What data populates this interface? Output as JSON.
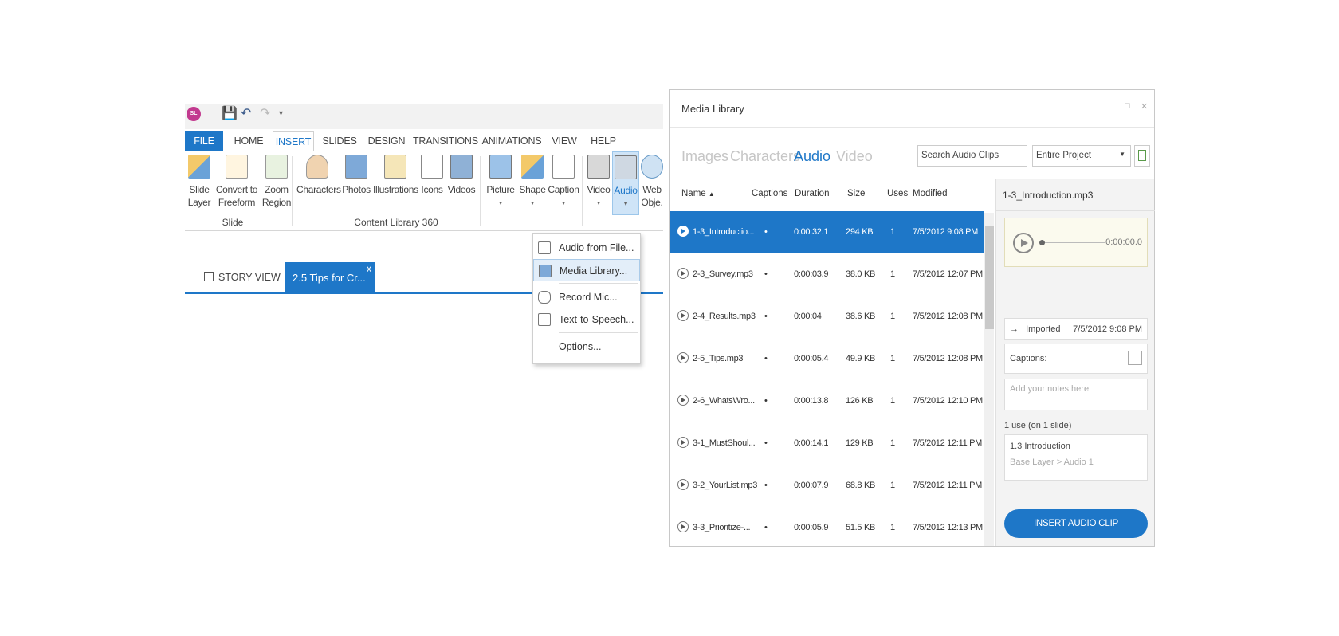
{
  "qat": {
    "logo": "SL"
  },
  "ribbon_tabs": [
    "FILE",
    "HOME",
    "INSERT",
    "SLIDES",
    "DESIGN",
    "TRANSITIONS",
    "ANIMATIONS",
    "VIEW",
    "HELP"
  ],
  "ribbon": {
    "slide_layer": "Slide\nLayer",
    "convert": "Convert to\nFreeform",
    "zoom": "Zoom\nRegion",
    "slide_group": "Slide",
    "characters": "Characters",
    "photos": "Photos",
    "illustrations": "Illustrations",
    "icons": "Icons",
    "videos": "Videos",
    "content_group": "Content Library 360",
    "picture": "Picture",
    "shape": "Shape",
    "caption": "Caption",
    "video": "Video",
    "audio": "Audio",
    "web": "Web\nObje."
  },
  "story": {
    "view_label": "STORY VIEW",
    "slide_tab": "2.5 Tips for Cr...",
    "close": "x"
  },
  "audio_menu": [
    "Audio from File...",
    "Media Library...",
    "Record Mic...",
    "Text-to-Speech...",
    "Options..."
  ],
  "media_library": {
    "title": "Media Library",
    "tabs": [
      "Images",
      "Characters",
      "Audio",
      "Video"
    ],
    "search_placeholder": "Search Audio Clips",
    "scope": "Entire Project",
    "columns": [
      "Name",
      "Captions",
      "Duration",
      "Size",
      "Uses",
      "Modified"
    ],
    "rows": [
      {
        "name": "1-3_Introductio...",
        "captions": "•",
        "duration": "0:00:32.1",
        "size": "294 KB",
        "uses": "1",
        "modified": "7/5/2012 9:08 PM"
      },
      {
        "name": "2-3_Survey.mp3",
        "captions": "•",
        "duration": "0:00:03.9",
        "size": "38.0 KB",
        "uses": "1",
        "modified": "7/5/2012 12:07 PM"
      },
      {
        "name": "2-4_Results.mp3",
        "captions": "•",
        "duration": "0:00:04",
        "size": "38.6 KB",
        "uses": "1",
        "modified": "7/5/2012 12:08 PM"
      },
      {
        "name": "2-5_Tips.mp3",
        "captions": "•",
        "duration": "0:00:05.4",
        "size": "49.9 KB",
        "uses": "1",
        "modified": "7/5/2012 12:08 PM"
      },
      {
        "name": "2-6_WhatsWro...",
        "captions": "•",
        "duration": "0:00:13.8",
        "size": "126 KB",
        "uses": "1",
        "modified": "7/5/2012 12:10 PM"
      },
      {
        "name": "3-1_MustShoul...",
        "captions": "•",
        "duration": "0:00:14.1",
        "size": "129 KB",
        "uses": "1",
        "modified": "7/5/2012 12:11 PM"
      },
      {
        "name": "3-2_YourList.mp3",
        "captions": "•",
        "duration": "0:00:07.9",
        "size": "68.8 KB",
        "uses": "1",
        "modified": "7/5/2012 12:11 PM"
      },
      {
        "name": "3-3_Prioritize-...",
        "captions": "•",
        "duration": "0:00:05.9",
        "size": "51.5 KB",
        "uses": "1",
        "modified": "7/5/2012 12:13 PM"
      }
    ],
    "detail": {
      "filename": "1-3_Introduction.mp3",
      "time": "0:00:00.0",
      "imported_label": "Imported",
      "imported_date": "7/5/2012 9:08 PM",
      "captions_label": "Captions:",
      "notes_placeholder": "Add your notes here",
      "uses": "1 use (on 1 slide)",
      "use_slide": "1.3 Introduction",
      "use_path": "Base Layer > Audio 1",
      "insert_button": "INSERT AUDIO CLIP"
    }
  },
  "colors": {
    "accent": "#1e77c8",
    "selected_row": "#1e77c8",
    "player_bg": "#fbfaee"
  }
}
